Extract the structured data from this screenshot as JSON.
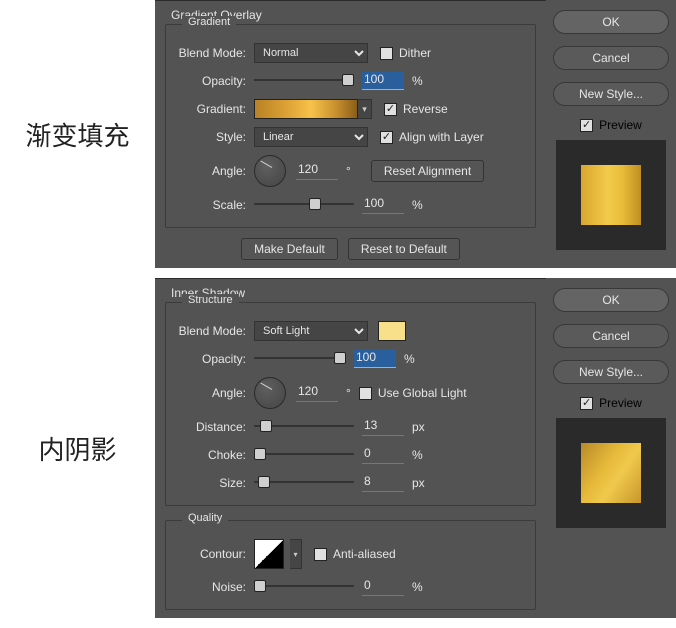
{
  "p1": {
    "cn_label": "渐变填充",
    "title": "Gradient Overlay",
    "group": "Gradient",
    "blend_mode_lbl": "Blend Mode:",
    "blend_mode_val": "Normal",
    "dither_lbl": "Dither",
    "opacity_lbl": "Opacity:",
    "opacity_val": "100",
    "pct": "%",
    "gradient_lbl": "Gradient:",
    "reverse_lbl": "Reverse",
    "style_lbl": "Style:",
    "style_val": "Linear",
    "align_lbl": "Align with Layer",
    "angle_lbl": "Angle:",
    "angle_val": "120",
    "deg": "°",
    "reset_align": "Reset Alignment",
    "scale_lbl": "Scale:",
    "scale_val": "100",
    "make_default": "Make Default",
    "reset_default": "Reset to Default"
  },
  "p2": {
    "cn_label": "内阴影",
    "title": "Inner Shadow",
    "group": "Structure",
    "blend_mode_lbl": "Blend Mode:",
    "blend_mode_val": "Soft Light",
    "color": "#f8e08a",
    "opacity_lbl": "Opacity:",
    "opacity_val": "100",
    "pct": "%",
    "angle_lbl": "Angle:",
    "angle_val": "120",
    "deg": "°",
    "global_lbl": "Use Global Light",
    "distance_lbl": "Distance:",
    "distance_val": "13",
    "px": "px",
    "choke_lbl": "Choke:",
    "choke_val": "0",
    "size_lbl": "Size:",
    "size_val": "8",
    "group2": "Quality",
    "contour_lbl": "Contour:",
    "aa_lbl": "Anti-aliased",
    "noise_lbl": "Noise:",
    "noise_val": "0"
  },
  "side": {
    "ok": "OK",
    "cancel": "Cancel",
    "new_style": "New Style...",
    "preview": "Preview"
  }
}
